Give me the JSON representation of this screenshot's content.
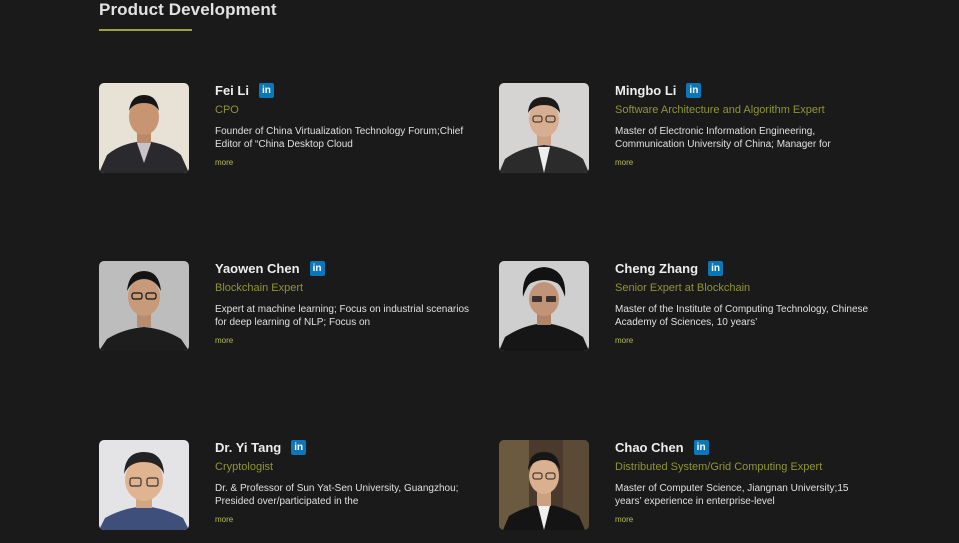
{
  "section": {
    "title": "Product Development"
  },
  "colors": {
    "background": "#1a1a1a",
    "accent": "#9aa33e",
    "role_text": "#8f9631",
    "linkedin": "#0b76b8"
  },
  "members": [
    {
      "name": "Fei Li",
      "role": "CPO",
      "desc": "Founder of China Virtualization Technology Forum;Chief Editor of “China Desktop Cloud",
      "more": "more",
      "linkedin_icon": "in"
    },
    {
      "name": "Mingbo Li",
      "role": "Software Architecture and Algorithm Expert",
      "desc": "Master of Electronic Information Engineering, Communication University of China; Manager for",
      "more": "more",
      "linkedin_icon": "in"
    },
    {
      "name": "Yaowen Chen",
      "role": "Blockchain Expert",
      "desc": "Expert at machine learning; Focus on industrial scenarios for deep learning of NLP; Focus on",
      "more": "more",
      "linkedin_icon": "in"
    },
    {
      "name": "Cheng Zhang",
      "role": "Senior Expert at Blockchain",
      "desc": "Master of the Institute of Computing Technology, Chinese Academy of Sciences, 10 years’",
      "more": "more",
      "linkedin_icon": "in"
    },
    {
      "name": "Dr. Yi Tang",
      "role": "Cryptologist",
      "desc": "Dr. & Professor of Sun Yat-Sen University, Guangzhou; Presided over/participated in the",
      "more": "more",
      "linkedin_icon": "in"
    },
    {
      "name": "Chao Chen",
      "role": "Distributed System/Grid Computing Expert",
      "desc": "Master of Computer Science, Jiangnan University;15 years’ experience in enterprise-level",
      "more": "more",
      "linkedin_icon": "in"
    }
  ]
}
